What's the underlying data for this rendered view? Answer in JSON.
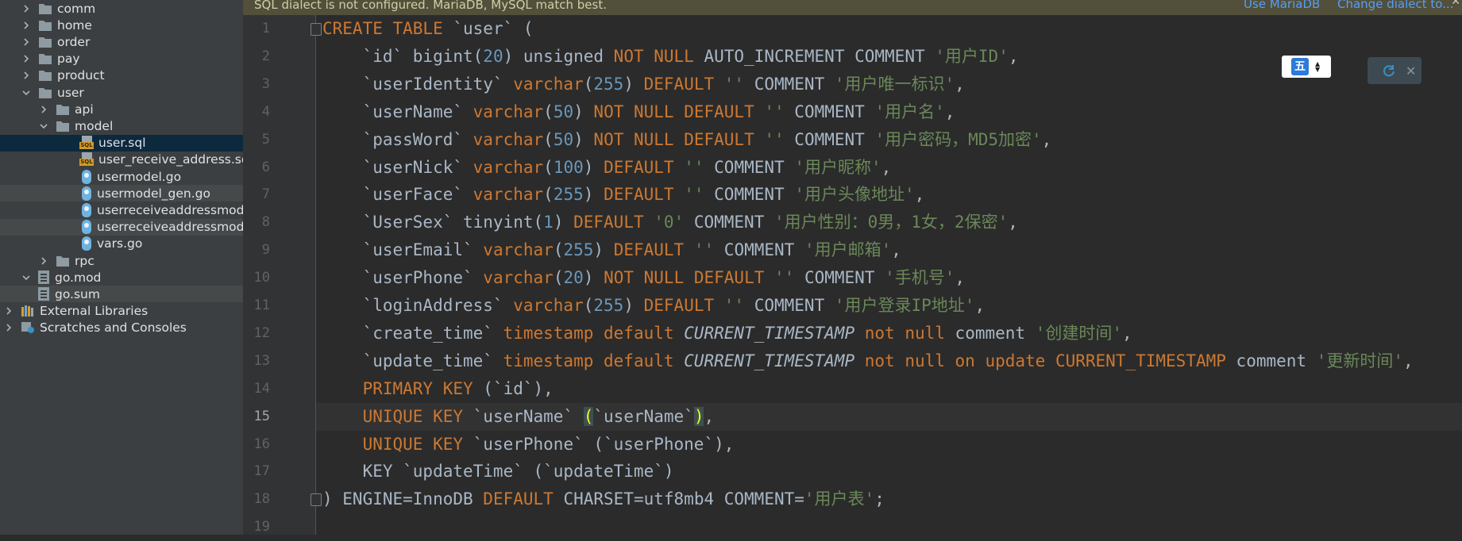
{
  "sidebar": {
    "items": [
      {
        "label": "comm",
        "type": "folder",
        "expanded": false,
        "depth": 1
      },
      {
        "label": "home",
        "type": "folder",
        "expanded": false,
        "depth": 1
      },
      {
        "label": "order",
        "type": "folder",
        "expanded": false,
        "depth": 1
      },
      {
        "label": "pay",
        "type": "folder",
        "expanded": false,
        "depth": 1
      },
      {
        "label": "product",
        "type": "folder",
        "expanded": false,
        "depth": 1
      },
      {
        "label": "user",
        "type": "folder",
        "expanded": true,
        "depth": 1
      },
      {
        "label": "api",
        "type": "folder",
        "expanded": false,
        "depth": 2
      },
      {
        "label": "model",
        "type": "folder",
        "expanded": true,
        "depth": 2
      },
      {
        "label": "user.sql",
        "type": "sql",
        "depth": 3,
        "selected": true
      },
      {
        "label": "user_receive_address.sql",
        "type": "sql",
        "depth": 3
      },
      {
        "label": "usermodel.go",
        "type": "go",
        "depth": 3
      },
      {
        "label": "usermodel_gen.go",
        "type": "go",
        "depth": 3,
        "shaded": true
      },
      {
        "label": "userreceiveaddressmodel",
        "type": "go",
        "depth": 3
      },
      {
        "label": "userreceiveaddressmodel",
        "type": "go",
        "depth": 3,
        "shaded": true
      },
      {
        "label": "vars.go",
        "type": "go",
        "depth": 3
      },
      {
        "label": "rpc",
        "type": "folder",
        "expanded": false,
        "depth": 2
      },
      {
        "label": "go.mod",
        "type": "mod",
        "expanded": true,
        "depth": 1
      },
      {
        "label": "go.sum",
        "type": "mod",
        "depth": 2,
        "shaded": true
      },
      {
        "label": "External Libraries",
        "type": "lib",
        "expanded": false,
        "depth": 0
      },
      {
        "label": "Scratches and Consoles",
        "type": "scratch",
        "expanded": false,
        "depth": 0
      }
    ]
  },
  "banner": {
    "text": "SQL dialect is not configured. MariaDB, MySQL match best.",
    "use_mariadb": "Use MariaDB",
    "change_dialect": "Change dialect to...",
    "close": "✕"
  },
  "ime": {
    "glyph": "五",
    "arrows": "▲▼"
  },
  "notification": {
    "close": "✕"
  },
  "editor": {
    "current_line": 15,
    "lines": [
      {
        "n": "1",
        "tokens": [
          {
            "t": "CREATE TABLE ",
            "c": "kw"
          },
          {
            "t": "`user` ("
          }
        ]
      },
      {
        "n": "2",
        "tokens": [
          {
            "t": "    `id` bigint("
          },
          {
            "t": "20",
            "c": "num"
          },
          {
            "t": ") unsigned "
          },
          {
            "t": "NOT NULL ",
            "c": "kw"
          },
          {
            "t": "AUTO_INCREMENT COMMENT "
          },
          {
            "t": "'用户ID'",
            "c": "str"
          },
          {
            "t": ","
          }
        ]
      },
      {
        "n": "3",
        "tokens": [
          {
            "t": "    `userIdentity` "
          },
          {
            "t": "varchar",
            "c": "kw"
          },
          {
            "t": "("
          },
          {
            "t": "255",
            "c": "num"
          },
          {
            "t": ") "
          },
          {
            "t": "DEFAULT ",
            "c": "kw"
          },
          {
            "t": "'' ",
            "c": "str"
          },
          {
            "t": "COMMENT "
          },
          {
            "t": "'用户唯一标识'",
            "c": "str"
          },
          {
            "t": ","
          }
        ]
      },
      {
        "n": "4",
        "tokens": [
          {
            "t": "    `userName` "
          },
          {
            "t": "varchar",
            "c": "kw"
          },
          {
            "t": "("
          },
          {
            "t": "50",
            "c": "num"
          },
          {
            "t": ") "
          },
          {
            "t": "NOT NULL DEFAULT ",
            "c": "kw"
          },
          {
            "t": "'' ",
            "c": "str"
          },
          {
            "t": "COMMENT "
          },
          {
            "t": "'用户名'",
            "c": "str"
          },
          {
            "t": ","
          }
        ]
      },
      {
        "n": "5",
        "tokens": [
          {
            "t": "    `passWord` "
          },
          {
            "t": "varchar",
            "c": "kw"
          },
          {
            "t": "("
          },
          {
            "t": "50",
            "c": "num"
          },
          {
            "t": ") "
          },
          {
            "t": "NOT NULL DEFAULT ",
            "c": "kw"
          },
          {
            "t": "'' ",
            "c": "str"
          },
          {
            "t": "COMMENT "
          },
          {
            "t": "'用户密码，MD5加密'",
            "c": "str"
          },
          {
            "t": ","
          }
        ]
      },
      {
        "n": "6",
        "tokens": [
          {
            "t": "    `userNick` "
          },
          {
            "t": "varchar",
            "c": "kw"
          },
          {
            "t": "("
          },
          {
            "t": "100",
            "c": "num"
          },
          {
            "t": ") "
          },
          {
            "t": "DEFAULT ",
            "c": "kw"
          },
          {
            "t": "'' ",
            "c": "str"
          },
          {
            "t": "COMMENT "
          },
          {
            "t": "'用户昵称'",
            "c": "str"
          },
          {
            "t": ","
          }
        ]
      },
      {
        "n": "7",
        "tokens": [
          {
            "t": "    `userFace` "
          },
          {
            "t": "varchar",
            "c": "kw"
          },
          {
            "t": "("
          },
          {
            "t": "255",
            "c": "num"
          },
          {
            "t": ") "
          },
          {
            "t": "DEFAULT ",
            "c": "kw"
          },
          {
            "t": "'' ",
            "c": "str"
          },
          {
            "t": "COMMENT "
          },
          {
            "t": "'用户头像地址'",
            "c": "str"
          },
          {
            "t": ","
          }
        ]
      },
      {
        "n": "8",
        "tokens": [
          {
            "t": "    `UserSex` tinyint("
          },
          {
            "t": "1",
            "c": "num"
          },
          {
            "t": ") "
          },
          {
            "t": "DEFAULT ",
            "c": "kw"
          },
          {
            "t": "'0' ",
            "c": "str"
          },
          {
            "t": "COMMENT "
          },
          {
            "t": "'用户性别：0男，1女，2保密'",
            "c": "str"
          },
          {
            "t": ","
          }
        ]
      },
      {
        "n": "9",
        "tokens": [
          {
            "t": "    `userEmail` "
          },
          {
            "t": "varchar",
            "c": "kw"
          },
          {
            "t": "("
          },
          {
            "t": "255",
            "c": "num"
          },
          {
            "t": ") "
          },
          {
            "t": "DEFAULT ",
            "c": "kw"
          },
          {
            "t": "'' ",
            "c": "str"
          },
          {
            "t": "COMMENT "
          },
          {
            "t": "'用户邮箱'",
            "c": "str"
          },
          {
            "t": ","
          }
        ]
      },
      {
        "n": "10",
        "tokens": [
          {
            "t": "    `userPhone` "
          },
          {
            "t": "varchar",
            "c": "kw"
          },
          {
            "t": "("
          },
          {
            "t": "20",
            "c": "num"
          },
          {
            "t": ") "
          },
          {
            "t": "NOT NULL DEFAULT ",
            "c": "kw"
          },
          {
            "t": "'' ",
            "c": "str"
          },
          {
            "t": "COMMENT "
          },
          {
            "t": "'手机号'",
            "c": "str"
          },
          {
            "t": ","
          }
        ]
      },
      {
        "n": "11",
        "tokens": [
          {
            "t": "    `loginAddress` "
          },
          {
            "t": "varchar",
            "c": "kw"
          },
          {
            "t": "("
          },
          {
            "t": "255",
            "c": "num"
          },
          {
            "t": ") "
          },
          {
            "t": "DEFAULT ",
            "c": "kw"
          },
          {
            "t": "'' ",
            "c": "str"
          },
          {
            "t": "COMMENT "
          },
          {
            "t": "'用户登录IP地址'",
            "c": "str"
          },
          {
            "t": ","
          }
        ]
      },
      {
        "n": "12",
        "tokens": [
          {
            "t": "    `create_time` "
          },
          {
            "t": "timestamp default ",
            "c": "kw"
          },
          {
            "t": "CURRENT_TIMESTAMP",
            "c": "it"
          },
          {
            "t": " "
          },
          {
            "t": "not null ",
            "c": "kw"
          },
          {
            "t": "comment "
          },
          {
            "t": "'创建时间'",
            "c": "str"
          },
          {
            "t": ","
          }
        ]
      },
      {
        "n": "13",
        "tokens": [
          {
            "t": "    `update_time` "
          },
          {
            "t": "timestamp default ",
            "c": "kw"
          },
          {
            "t": "CURRENT_TIMESTAMP",
            "c": "it"
          },
          {
            "t": " "
          },
          {
            "t": "not null on update CURRENT_TIMESTAMP ",
            "c": "kw"
          },
          {
            "t": "comment "
          },
          {
            "t": "'更新时间'",
            "c": "str"
          },
          {
            "t": ","
          }
        ]
      },
      {
        "n": "14",
        "tokens": [
          {
            "t": "    "
          },
          {
            "t": "PRIMARY KEY ",
            "c": "kw"
          },
          {
            "t": "(`id`),"
          }
        ]
      },
      {
        "n": "15",
        "tokens": [
          {
            "t": "    "
          },
          {
            "t": "UNIQUE KEY ",
            "c": "kw"
          },
          {
            "t": "`userName` "
          },
          {
            "t": "(",
            "c": "hl"
          },
          {
            "t": "`userName`"
          },
          {
            "t": ")",
            "c": "hl"
          },
          {
            "t": ","
          }
        ]
      },
      {
        "n": "16",
        "tokens": [
          {
            "t": "    "
          },
          {
            "t": "UNIQUE KEY ",
            "c": "kw"
          },
          {
            "t": "`userPhone` (`userPhone`),"
          }
        ]
      },
      {
        "n": "17",
        "tokens": [
          {
            "t": "    KEY `updateTime` (`updateTime`)"
          }
        ]
      },
      {
        "n": "18",
        "tokens": [
          {
            "t": ") ENGINE=InnoDB "
          },
          {
            "t": "DEFAULT ",
            "c": "kw"
          },
          {
            "t": "CHARSET=utf8mb4 COMMENT="
          },
          {
            "t": "'用户表'",
            "c": "str"
          },
          {
            "t": ";"
          }
        ]
      },
      {
        "n": "19",
        "tokens": []
      }
    ]
  },
  "colors": {
    "background": "#2b2b2b",
    "sidebar": "#3c3f41",
    "keyword": "#cc7832",
    "string": "#6a8759",
    "number": "#6897bb",
    "text": "#a9b7c6",
    "banner": "#52503a",
    "link": "#589df6"
  }
}
